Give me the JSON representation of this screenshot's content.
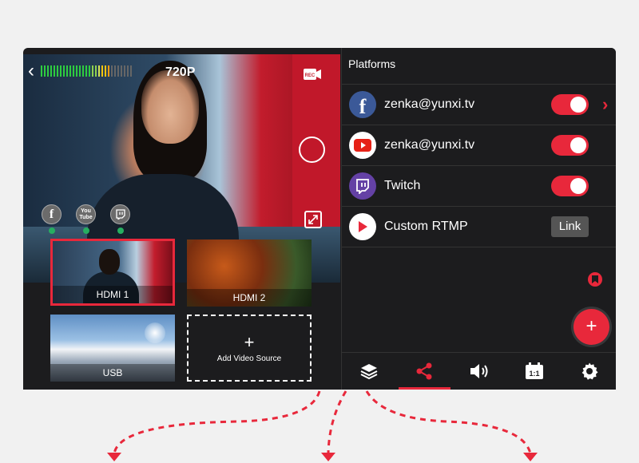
{
  "preview": {
    "resolution": "720P",
    "meter_colors": [
      "#2ecc40",
      "#2ecc40",
      "#2ecc40",
      "#2ecc40",
      "#2ecc40",
      "#2ecc40",
      "#2ecc40",
      "#2ecc40",
      "#2ecc40",
      "#2ecc40",
      "#2ecc40",
      "#2ecc40",
      "#2ecc40",
      "#2ecc40",
      "#2ecc40",
      "#2ecc40",
      "#8fd14f",
      "#8fd14f",
      "#d4e157",
      "#f1c40f",
      "#f1c40f",
      "#f39c12",
      "#666",
      "#666",
      "#666",
      "#666",
      "#666",
      "#666",
      "#666"
    ],
    "badges": [
      {
        "name": "facebook",
        "glyph": "f"
      },
      {
        "name": "youtube",
        "glyph": "You Tube"
      },
      {
        "name": "twitch",
        "glyph": "⌂"
      }
    ]
  },
  "sources": [
    {
      "label": "HDMI 1",
      "selected": true
    },
    {
      "label": "HDMI 2",
      "selected": false
    },
    {
      "label": "USB",
      "selected": false
    }
  ],
  "add_source": {
    "label": "Add Video Source"
  },
  "panel": {
    "title": "Platforms",
    "rows": [
      {
        "name": "zenka@yunxi.tv",
        "platform": "facebook-icon",
        "enabled": true,
        "color": "#3b5998"
      },
      {
        "name": "zenka@yunxi.tv",
        "platform": "youtube-icon",
        "enabled": true,
        "color": "#ffffff"
      },
      {
        "name": "Twitch",
        "platform": "twitch-icon",
        "enabled": true,
        "color": "#6441a5"
      },
      {
        "name": "Custom RTMP",
        "platform": "rtmp-icon",
        "link_label": "Link",
        "color": "#ffffff"
      }
    ]
  },
  "tabs": [
    "layers-icon",
    "share-icon",
    "volume-icon",
    "aspect-ratio-icon",
    "settings-icon"
  ],
  "active_tab": 1,
  "colors": {
    "accent": "#e8283b",
    "background": "#1c1c1e"
  }
}
